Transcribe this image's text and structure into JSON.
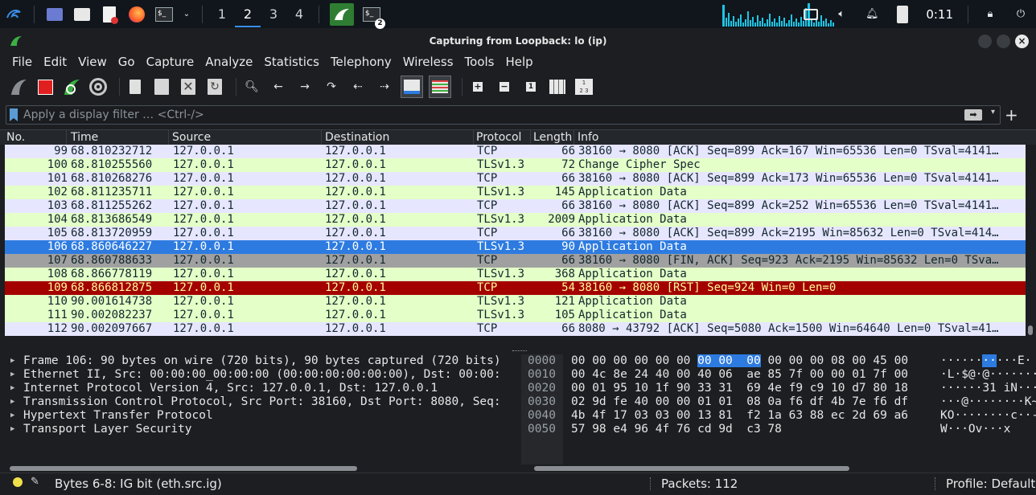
{
  "taskbar": {
    "workspaces": [
      "1",
      "2",
      "3",
      "4"
    ],
    "active_workspace": "2",
    "clock": "0:11",
    "terminal_badge": "2",
    "icons": [
      "kali-menu-icon",
      "desktop-icon",
      "files-icon",
      "text-editor-icon",
      "firefox-icon",
      "terminal-icon",
      "chevron-down-icon",
      "wireshark-icon",
      "terminal-icon",
      "network-icon",
      "volume-icon",
      "bell-icon",
      "battery-icon",
      "lock-icon",
      "power-icon"
    ]
  },
  "window": {
    "title": "Capturing from Loopback: lo (ip)"
  },
  "menubar": {
    "items": [
      "File",
      "Edit",
      "View",
      "Go",
      "Capture",
      "Analyze",
      "Statistics",
      "Telephony",
      "Wireless",
      "Tools",
      "Help"
    ],
    "underline_first": [
      true,
      true,
      true,
      true,
      true,
      true,
      true,
      true,
      true,
      true,
      true
    ]
  },
  "toolbar": {
    "icons": [
      "start-capture-icon",
      "stop-capture-icon",
      "restart-capture-icon",
      "capture-options-icon",
      "open-file-icon",
      "save-file-icon",
      "close-file-icon",
      "reload-file-icon",
      "find-packet-icon",
      "go-back-icon",
      "go-forward-icon",
      "go-to-packet-icon",
      "go-first-icon",
      "go-last-icon",
      "autoscroll-icon",
      "colorize-icon",
      "zoom-in-icon",
      "zoom-out-icon",
      "normal-size-icon",
      "resize-columns-icon",
      "layout-icon"
    ]
  },
  "filter": {
    "placeholder": "Apply a display filter … <Ctrl-/>",
    "value": ""
  },
  "packet_list": {
    "columns": [
      "No.",
      "Time",
      "Source",
      "Destination",
      "Protocol",
      "Length",
      "Info"
    ],
    "rows": [
      {
        "no": "99",
        "time": "68.810232712",
        "src": "127.0.0.1",
        "dst": "127.0.0.1",
        "proto": "TCP",
        "len": "66",
        "info": "38160 → 8080 [ACK] Seq=899 Ack=167 Win=65536 Len=0 TSval=4141…",
        "bg": "#e7e6ff",
        "fg": "#12272e"
      },
      {
        "no": "100",
        "time": "68.810255560",
        "src": "127.0.0.1",
        "dst": "127.0.0.1",
        "proto": "TLSv1.3",
        "len": "72",
        "info": "Change Cipher Spec",
        "bg": "#e4ffc7",
        "fg": "#12272e"
      },
      {
        "no": "101",
        "time": "68.810268276",
        "src": "127.0.0.1",
        "dst": "127.0.0.1",
        "proto": "TCP",
        "len": "66",
        "info": "38160 → 8080 [ACK] Seq=899 Ack=173 Win=65536 Len=0 TSval=4141…",
        "bg": "#e7e6ff",
        "fg": "#12272e"
      },
      {
        "no": "102",
        "time": "68.811235711",
        "src": "127.0.0.1",
        "dst": "127.0.0.1",
        "proto": "TLSv1.3",
        "len": "145",
        "info": "Application Data",
        "bg": "#e4ffc7",
        "fg": "#12272e"
      },
      {
        "no": "103",
        "time": "68.811255262",
        "src": "127.0.0.1",
        "dst": "127.0.0.1",
        "proto": "TCP",
        "len": "66",
        "info": "38160 → 8080 [ACK] Seq=899 Ack=252 Win=65536 Len=0 TSval=4141…",
        "bg": "#e7e6ff",
        "fg": "#12272e"
      },
      {
        "no": "104",
        "time": "68.813686549",
        "src": "127.0.0.1",
        "dst": "127.0.0.1",
        "proto": "TLSv1.3",
        "len": "2009",
        "info": "Application Data",
        "bg": "#e4ffc7",
        "fg": "#12272e"
      },
      {
        "no": "105",
        "time": "68.813720959",
        "src": "127.0.0.1",
        "dst": "127.0.0.1",
        "proto": "TCP",
        "len": "66",
        "info": "38160 → 8080 [ACK] Seq=899 Ack=2195 Win=85632 Len=0 TSval=414…",
        "bg": "#e7e6ff",
        "fg": "#12272e"
      },
      {
        "no": "106",
        "time": "68.860646227",
        "src": "127.0.0.1",
        "dst": "127.0.0.1",
        "proto": "TLSv1.3",
        "len": "90",
        "info": "Application Data",
        "bg": "#2d7be0",
        "fg": "#ffffff"
      },
      {
        "no": "107",
        "time": "68.860788633",
        "src": "127.0.0.1",
        "dst": "127.0.0.1",
        "proto": "TCP",
        "len": "66",
        "info": "38160 → 8080 [FIN, ACK] Seq=923 Ack=2195 Win=85632 Len=0 TSva…",
        "bg": "#a0a0a0",
        "fg": "#12272e"
      },
      {
        "no": "108",
        "time": "68.866778119",
        "src": "127.0.0.1",
        "dst": "127.0.0.1",
        "proto": "TLSv1.3",
        "len": "368",
        "info": "Application Data",
        "bg": "#e4ffc7",
        "fg": "#12272e"
      },
      {
        "no": "109",
        "time": "68.866812875",
        "src": "127.0.0.1",
        "dst": "127.0.0.1",
        "proto": "TCP",
        "len": "54",
        "info": "38160 → 8080 [RST] Seq=924 Win=0 Len=0",
        "bg": "#a40000",
        "fg": "#fffc9c"
      },
      {
        "no": "110",
        "time": "90.001614738",
        "src": "127.0.0.1",
        "dst": "127.0.0.1",
        "proto": "TLSv1.3",
        "len": "121",
        "info": "Application Data",
        "bg": "#e4ffc7",
        "fg": "#12272e"
      },
      {
        "no": "111",
        "time": "90.002082237",
        "src": "127.0.0.1",
        "dst": "127.0.0.1",
        "proto": "TLSv1.3",
        "len": "105",
        "info": "Application Data",
        "bg": "#e4ffc7",
        "fg": "#12272e"
      },
      {
        "no": "112",
        "time": "90.002097667",
        "src": "127.0.0.1",
        "dst": "127.0.0.1",
        "proto": "TCP",
        "len": "66",
        "info": "8080 → 43792 [ACK] Seq=5080 Ack=1500 Win=64640 Len=0 TSval=41…",
        "bg": "#e7e6ff",
        "fg": "#12272e"
      }
    ]
  },
  "details": {
    "rows": [
      "Frame 106: 90 bytes on wire (720 bits), 90 bytes captured (720 bits)",
      "Ethernet II, Src: 00:00:00_00:00:00 (00:00:00:00:00:00), Dst: 00:00:",
      "Internet Protocol Version 4, Src: 127.0.0.1, Dst: 127.0.0.1",
      "Transmission Control Protocol, Src Port: 38160, Dst Port: 8080, Seq:",
      "Hypertext Transfer Protocol",
      "Transport Layer Security"
    ]
  },
  "hex": {
    "rows": [
      {
        "offset": "0000",
        "pre": "00 00 00 00 00 00 ",
        "hl": "00 00  00",
        "post": " 00 00 00 08 00 45 00",
        "ascii_pre": "······",
        "ascii_hl": "··",
        "ascii_post": "···E·"
      },
      {
        "offset": "0010",
        "pre": "00 4c 8e 24 40 00 40 06  ae 85 7f 00 00 01 7f 00",
        "hl": "",
        "post": "",
        "ascii_pre": "·L·$@·@·········",
        "ascii_hl": "",
        "ascii_post": ""
      },
      {
        "offset": "0020",
        "pre": "00 01 95 10 1f 90 33 31  69 4e f9 c9 10 d7 80 18",
        "hl": "",
        "post": "",
        "ascii_pre": "······31 iN······",
        "ascii_hl": "",
        "ascii_post": ""
      },
      {
        "offset": "0030",
        "pre": "02 9d fe 40 00 00 01 01  08 0a f6 df 4b 7e f6 df",
        "hl": "",
        "post": "",
        "ascii_pre": "···@········K~··",
        "ascii_hl": "",
        "ascii_post": ""
      },
      {
        "offset": "0040",
        "pre": "4b 4f 17 03 03 00 13 81  f2 1a 63 88 ec 2d 69 a6",
        "hl": "",
        "post": "",
        "ascii_pre": "KO········c··-i·",
        "ascii_hl": "",
        "ascii_post": ""
      },
      {
        "offset": "0050",
        "pre": "57 98 e4 96 4f 76 cd 9d  c3 78",
        "hl": "",
        "post": "",
        "ascii_pre": "W···Ov···x",
        "ascii_hl": "",
        "ascii_post": ""
      }
    ]
  },
  "status": {
    "field": "Bytes 6-8: IG bit (eth.src.ig)",
    "packets": "Packets: 112",
    "profile": "Profile: Default"
  }
}
